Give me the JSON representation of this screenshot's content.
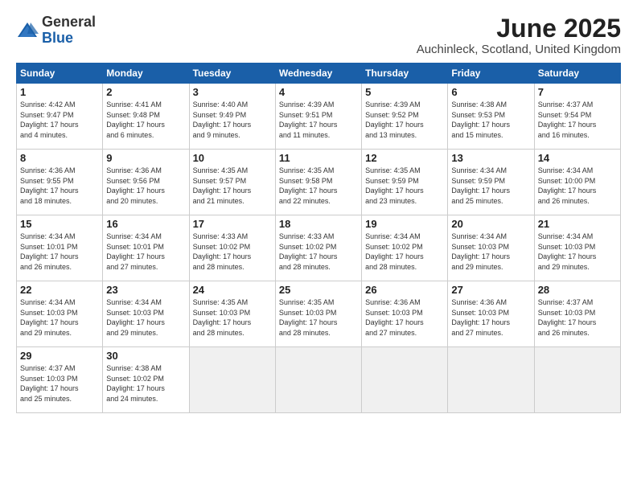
{
  "logo": {
    "general": "General",
    "blue": "Blue"
  },
  "title": "June 2025",
  "location": "Auchinleck, Scotland, United Kingdom",
  "days_header": [
    "Sunday",
    "Monday",
    "Tuesday",
    "Wednesday",
    "Thursday",
    "Friday",
    "Saturday"
  ],
  "weeks": [
    [
      {
        "day": "1",
        "info": "Sunrise: 4:42 AM\nSunset: 9:47 PM\nDaylight: 17 hours\nand 4 minutes."
      },
      {
        "day": "2",
        "info": "Sunrise: 4:41 AM\nSunset: 9:48 PM\nDaylight: 17 hours\nand 6 minutes."
      },
      {
        "day": "3",
        "info": "Sunrise: 4:40 AM\nSunset: 9:49 PM\nDaylight: 17 hours\nand 9 minutes."
      },
      {
        "day": "4",
        "info": "Sunrise: 4:39 AM\nSunset: 9:51 PM\nDaylight: 17 hours\nand 11 minutes."
      },
      {
        "day": "5",
        "info": "Sunrise: 4:39 AM\nSunset: 9:52 PM\nDaylight: 17 hours\nand 13 minutes."
      },
      {
        "day": "6",
        "info": "Sunrise: 4:38 AM\nSunset: 9:53 PM\nDaylight: 17 hours\nand 15 minutes."
      },
      {
        "day": "7",
        "info": "Sunrise: 4:37 AM\nSunset: 9:54 PM\nDaylight: 17 hours\nand 16 minutes."
      }
    ],
    [
      {
        "day": "8",
        "info": "Sunrise: 4:36 AM\nSunset: 9:55 PM\nDaylight: 17 hours\nand 18 minutes."
      },
      {
        "day": "9",
        "info": "Sunrise: 4:36 AM\nSunset: 9:56 PM\nDaylight: 17 hours\nand 20 minutes."
      },
      {
        "day": "10",
        "info": "Sunrise: 4:35 AM\nSunset: 9:57 PM\nDaylight: 17 hours\nand 21 minutes."
      },
      {
        "day": "11",
        "info": "Sunrise: 4:35 AM\nSunset: 9:58 PM\nDaylight: 17 hours\nand 22 minutes."
      },
      {
        "day": "12",
        "info": "Sunrise: 4:35 AM\nSunset: 9:59 PM\nDaylight: 17 hours\nand 23 minutes."
      },
      {
        "day": "13",
        "info": "Sunrise: 4:34 AM\nSunset: 9:59 PM\nDaylight: 17 hours\nand 25 minutes."
      },
      {
        "day": "14",
        "info": "Sunrise: 4:34 AM\nSunset: 10:00 PM\nDaylight: 17 hours\nand 26 minutes."
      }
    ],
    [
      {
        "day": "15",
        "info": "Sunrise: 4:34 AM\nSunset: 10:01 PM\nDaylight: 17 hours\nand 26 minutes."
      },
      {
        "day": "16",
        "info": "Sunrise: 4:34 AM\nSunset: 10:01 PM\nDaylight: 17 hours\nand 27 minutes."
      },
      {
        "day": "17",
        "info": "Sunrise: 4:33 AM\nSunset: 10:02 PM\nDaylight: 17 hours\nand 28 minutes."
      },
      {
        "day": "18",
        "info": "Sunrise: 4:33 AM\nSunset: 10:02 PM\nDaylight: 17 hours\nand 28 minutes."
      },
      {
        "day": "19",
        "info": "Sunrise: 4:34 AM\nSunset: 10:02 PM\nDaylight: 17 hours\nand 28 minutes."
      },
      {
        "day": "20",
        "info": "Sunrise: 4:34 AM\nSunset: 10:03 PM\nDaylight: 17 hours\nand 29 minutes."
      },
      {
        "day": "21",
        "info": "Sunrise: 4:34 AM\nSunset: 10:03 PM\nDaylight: 17 hours\nand 29 minutes."
      }
    ],
    [
      {
        "day": "22",
        "info": "Sunrise: 4:34 AM\nSunset: 10:03 PM\nDaylight: 17 hours\nand 29 minutes."
      },
      {
        "day": "23",
        "info": "Sunrise: 4:34 AM\nSunset: 10:03 PM\nDaylight: 17 hours\nand 29 minutes."
      },
      {
        "day": "24",
        "info": "Sunrise: 4:35 AM\nSunset: 10:03 PM\nDaylight: 17 hours\nand 28 minutes."
      },
      {
        "day": "25",
        "info": "Sunrise: 4:35 AM\nSunset: 10:03 PM\nDaylight: 17 hours\nand 28 minutes."
      },
      {
        "day": "26",
        "info": "Sunrise: 4:36 AM\nSunset: 10:03 PM\nDaylight: 17 hours\nand 27 minutes."
      },
      {
        "day": "27",
        "info": "Sunrise: 4:36 AM\nSunset: 10:03 PM\nDaylight: 17 hours\nand 27 minutes."
      },
      {
        "day": "28",
        "info": "Sunrise: 4:37 AM\nSunset: 10:03 PM\nDaylight: 17 hours\nand 26 minutes."
      }
    ],
    [
      {
        "day": "29",
        "info": "Sunrise: 4:37 AM\nSunset: 10:03 PM\nDaylight: 17 hours\nand 25 minutes."
      },
      {
        "day": "30",
        "info": "Sunrise: 4:38 AM\nSunset: 10:02 PM\nDaylight: 17 hours\nand 24 minutes."
      },
      {
        "day": "",
        "info": ""
      },
      {
        "day": "",
        "info": ""
      },
      {
        "day": "",
        "info": ""
      },
      {
        "day": "",
        "info": ""
      },
      {
        "day": "",
        "info": ""
      }
    ]
  ]
}
